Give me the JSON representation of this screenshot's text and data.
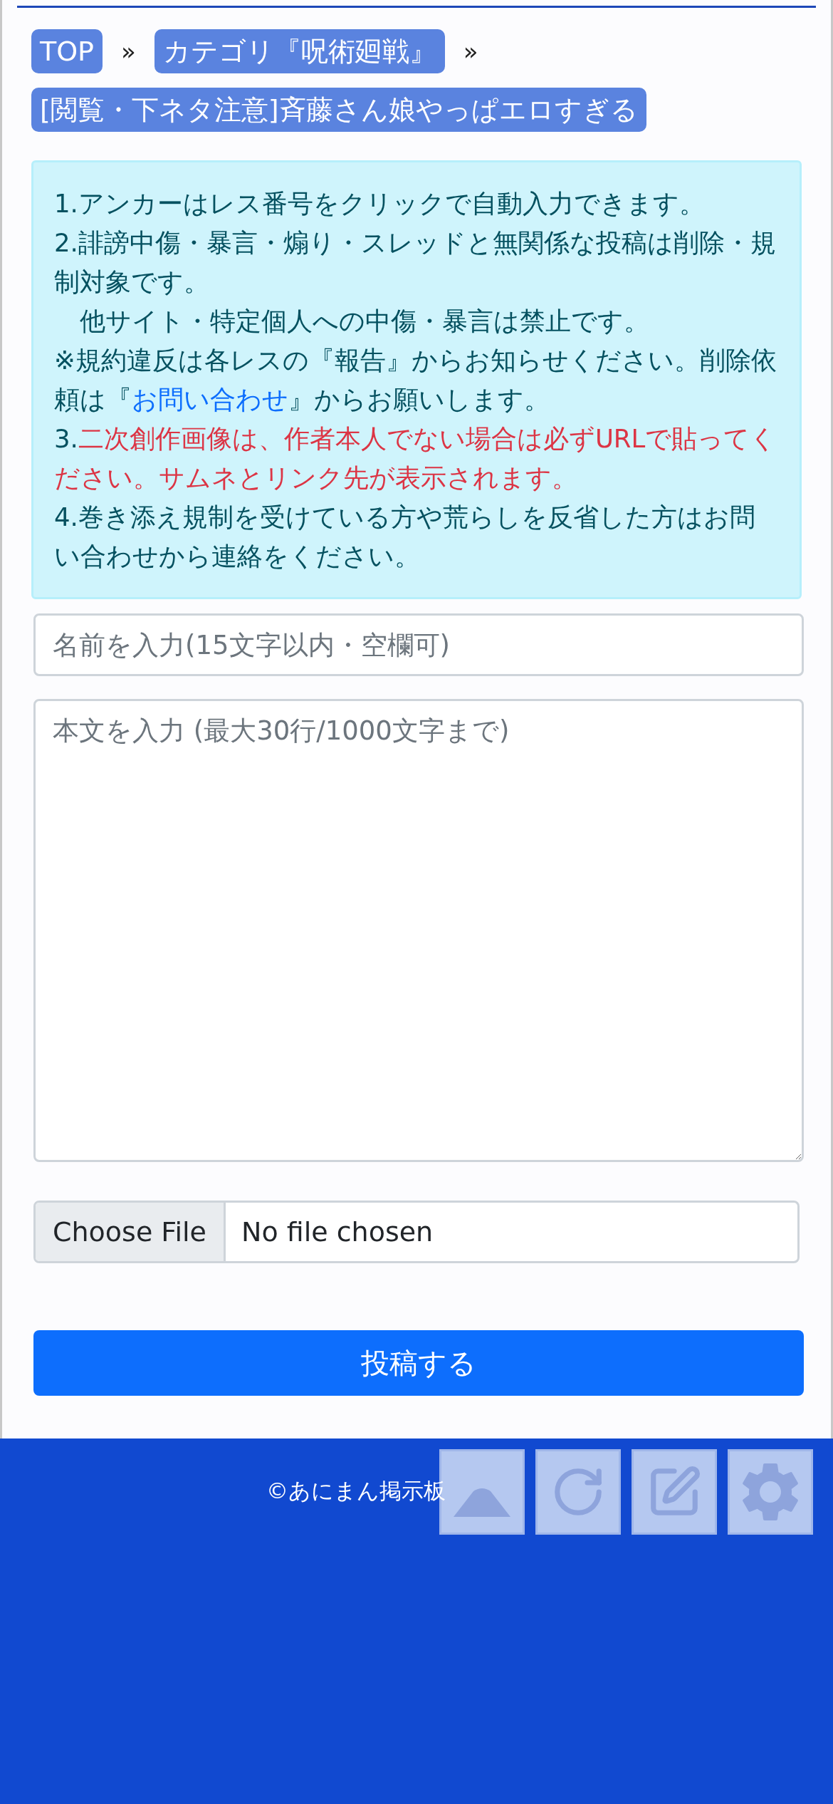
{
  "breadcrumbs": [
    {
      "label": "TOP",
      "separator": "»"
    },
    {
      "label": "カテゴリ『呪術廻戦』",
      "separator": "»"
    },
    {
      "label": "[閲覧・下ネタ注意]斉藤さん娘やっぱエロすぎる"
    }
  ],
  "notice": [
    {
      "indented": false,
      "segments": [
        {
          "kind": "plain",
          "text": "1.アンカーはレス番号をクリックで自動入力できます。"
        }
      ]
    },
    {
      "indented": false,
      "segments": [
        {
          "kind": "plain",
          "text": "2.誹謗中傷・暴言・煽り・スレッドと無関係な投稿は削除・規制対象です。"
        }
      ]
    },
    {
      "indented": true,
      "segments": [
        {
          "kind": "plain",
          "text": "他サイト・特定個人への中傷・暴言は禁止です。"
        }
      ]
    },
    {
      "indented": false,
      "segments": [
        {
          "kind": "plain",
          "text": "※規約違反は各レスの『報告』からお知らせください。削除依頼は『"
        },
        {
          "kind": "link",
          "text": "お問い合わせ"
        },
        {
          "kind": "plain",
          "text": "』からお願いします。"
        }
      ]
    },
    {
      "indented": false,
      "segments": [
        {
          "kind": "plain",
          "text": "3."
        },
        {
          "kind": "warning",
          "text": "二次創作画像は、作者本人でない場合は必ずURLで貼ってください。サムネとリンク先が表示されます。"
        }
      ]
    },
    {
      "indented": false,
      "segments": [
        {
          "kind": "plain",
          "text": "4.巻き添え規制を受けている方や荒らしを反省した方はお問い合わせから連絡をください。"
        }
      ]
    }
  ],
  "name_field": {
    "placeholder": "名前を入力(15文字以内・空欄可)"
  },
  "body_field": {
    "placeholder": "本文を入力 (最大30行/1000文字まで)"
  },
  "file_input": {
    "button": "Choose File",
    "status": "No file chosen"
  },
  "submit_button": "投稿する",
  "footer": {
    "copyright": "©あにまん掲示板"
  },
  "floating_buttons": [
    {
      "kind": "up"
    },
    {
      "kind": "reload"
    },
    {
      "kind": "edit"
    },
    {
      "kind": "settings"
    }
  ]
}
